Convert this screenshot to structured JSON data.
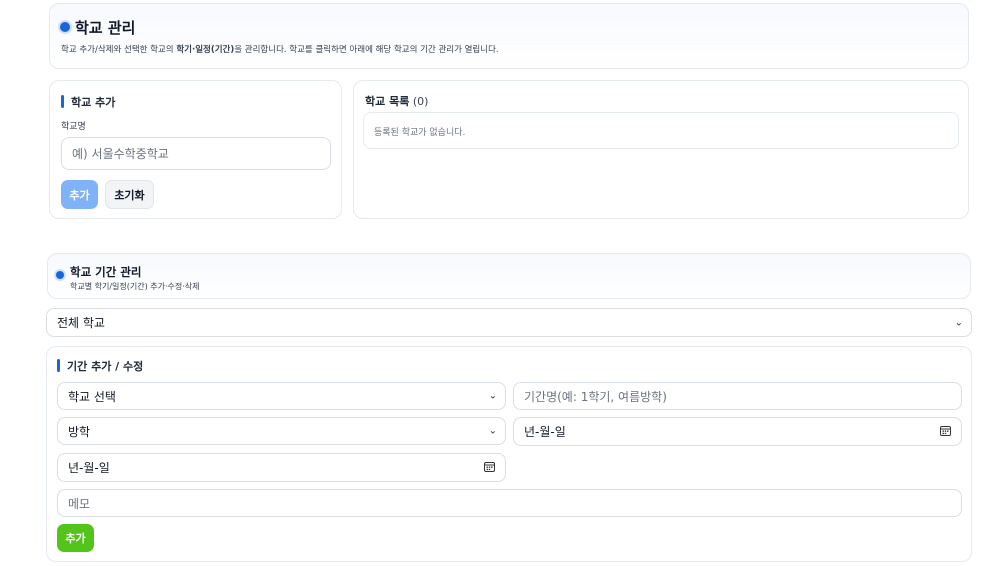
{
  "school_mgmt": {
    "title": "학교 관리",
    "desc_pre": "학교 추가/삭제와 선택한 학교의 ",
    "desc_bold": "학기·일정(기간)",
    "desc_post": "을 관리합니다. 학교를 클릭하면 아래에 해당 학교의 기간 관리가 열립니다."
  },
  "add_school": {
    "title": "학교 추가",
    "field_label": "학교명",
    "input_placeholder": "예) 서울수학중학교",
    "add_button": "추가",
    "reset_button": "초기화"
  },
  "school_list": {
    "title": "학교 목록",
    "count": "(0)",
    "empty_message": "등록된 학교가 없습니다."
  },
  "period_mgmt": {
    "title": "학교 기간 관리",
    "subtitle": "학교별 학기/일정(기간) 추가·수정·삭제",
    "filter_select": "전체 학교"
  },
  "period_form": {
    "title": "기간 추가 / 수정",
    "school_select": "학교 선택",
    "period_name_placeholder": "기간명(예: 1학기, 여름방학)",
    "type_select": "방학",
    "start_date_placeholder": "년-월-일",
    "end_date_placeholder": "년-월-일",
    "memo_placeholder": "메모",
    "add_button": "추가"
  },
  "colors": {
    "accent": "#1a66d9",
    "primary_button_disabled": "#7fb2f7",
    "success_button": "#52c41a"
  }
}
